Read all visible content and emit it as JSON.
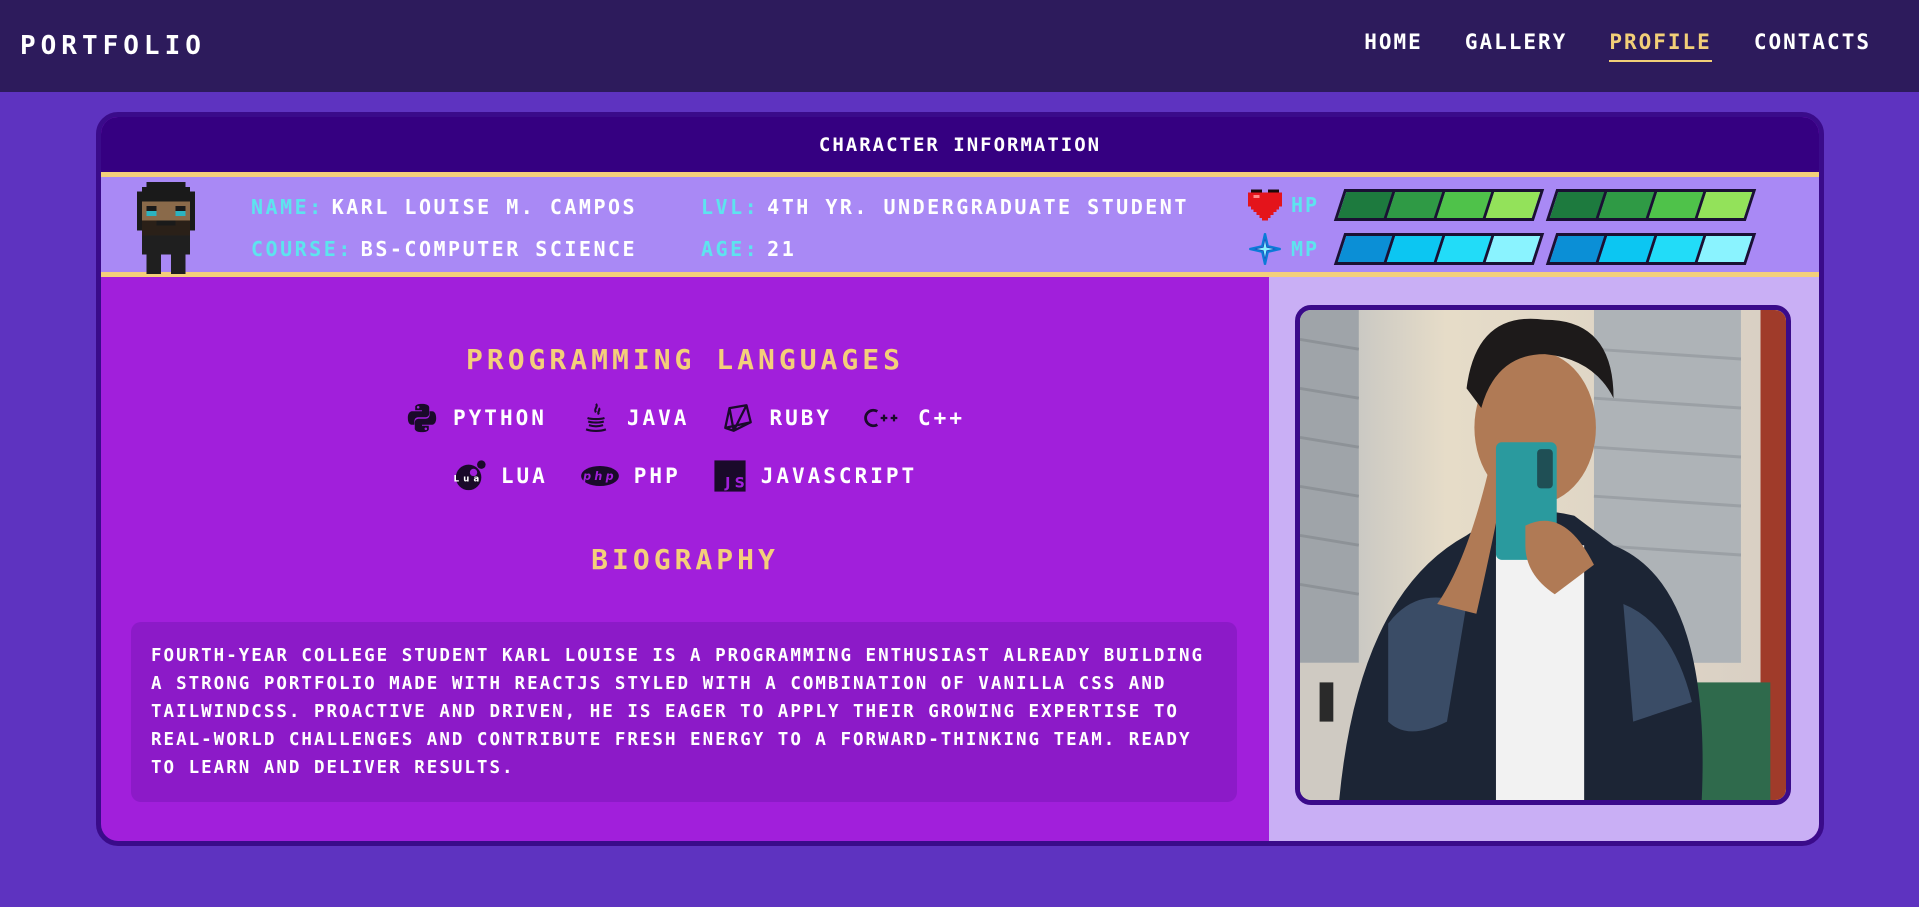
{
  "nav": {
    "brand": "PORTFOLIO",
    "items": [
      {
        "label": "HOME",
        "active": false
      },
      {
        "label": "GALLERY",
        "active": false
      },
      {
        "label": "PROFILE",
        "active": true
      },
      {
        "label": "CONTACTS",
        "active": false
      }
    ]
  },
  "card": {
    "title": "CHARACTER INFORMATION",
    "stats": {
      "name_key": "NAME:",
      "name_val": "KARL LOUISE M. CAMPOS",
      "lvl_key": "LVL:",
      "lvl_val": "4TH YR. UNDERGRADUATE STUDENT",
      "course_key": "COURSE:",
      "course_val": "BS-COMPUTER SCIENCE",
      "age_key": "AGE:",
      "age_val": "21",
      "hp_label": "HP",
      "mp_label": "MP",
      "hp_fill": 1.0,
      "mp_fill": 1.0
    },
    "languages_title": "PROGRAMMING LANGUAGES",
    "languages_row1": [
      {
        "label": "PYTHON",
        "icon": "python-icon"
      },
      {
        "label": "JAVA",
        "icon": "java-icon"
      },
      {
        "label": "RUBY",
        "icon": "ruby-icon"
      },
      {
        "label": "C++",
        "icon": "cpp-icon"
      }
    ],
    "languages_row2": [
      {
        "label": "LUA",
        "icon": "lua-icon"
      },
      {
        "label": "PHP",
        "icon": "php-icon"
      },
      {
        "label": "JAVASCRIPT",
        "icon": "javascript-icon"
      }
    ],
    "biography_title": "BIOGRAPHY",
    "biography": "FOURTH-YEAR COLLEGE STUDENT KARL LOUISE IS A PROGRAMMING ENTHUSIAST ALREADY BUILDING A STRONG PORTFOLIO MADE WITH REACTJS STYLED WITH A COMBINATION OF VANILLA CSS AND TAILWINDCSS. PROACTIVE AND DRIVEN, HE IS EAGER TO APPLY THEIR GROWING EXPERTISE TO REAL-WORLD CHALLENGES AND CONTRIBUTE FRESH ENERGY TO A FORWARD-THINKING TEAM. READY TO LEARN AND DELIVER RESULTS."
  },
  "colors": {
    "page_bg": "#5e33c0",
    "nav_bg": "#2d1b5c",
    "accent": "#f4cf7a",
    "key_cyan": "#5de4ee",
    "card_bg": "#a11fdb"
  }
}
